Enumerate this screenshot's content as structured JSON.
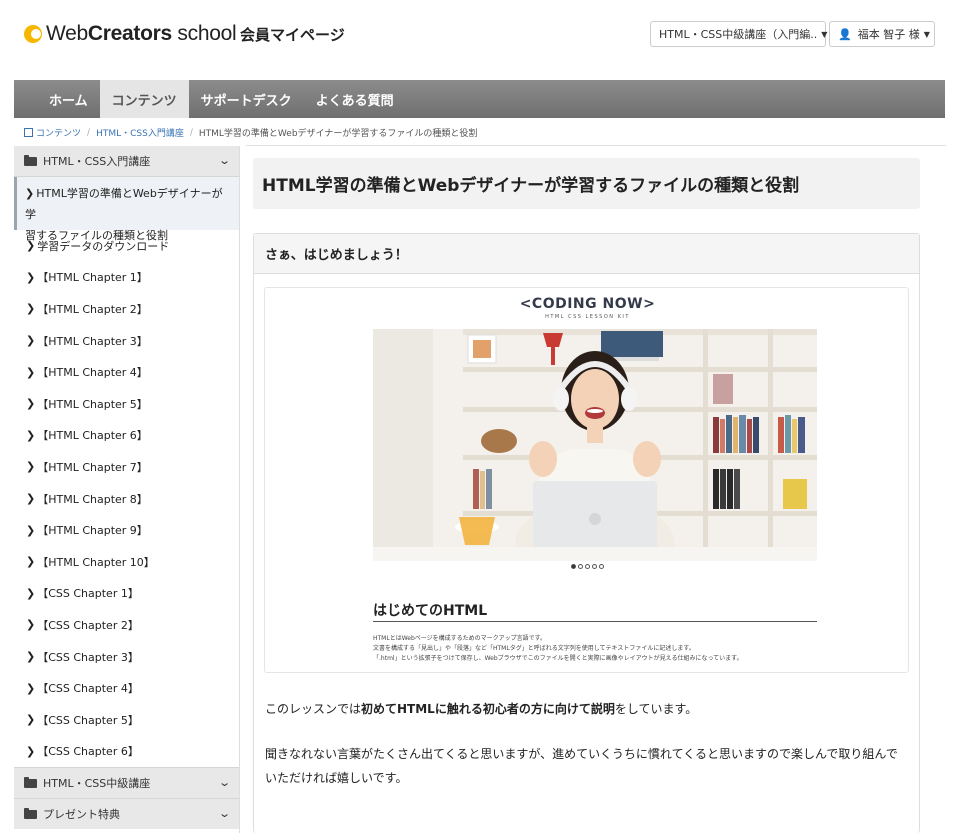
{
  "header": {
    "logo_web": "Web",
    "logo_creators": "Creators",
    "logo_school": "school",
    "mypage": "会員マイページ",
    "course_selector": "HTML・CSS中級講座（入門編..",
    "user": "福本 智子 様"
  },
  "nav": {
    "items": [
      {
        "label": "ホーム"
      },
      {
        "label": "コンテンツ",
        "active": true
      },
      {
        "label": "サポートデスク"
      },
      {
        "label": "よくある質問"
      }
    ]
  },
  "breadcrumb": {
    "items": [
      "コンテンツ",
      "HTML・CSS入門講座",
      "HTML学習の準備とWebデザイナーが学習するファイルの種類と役割"
    ]
  },
  "sidebar": {
    "section_title": "HTML・CSS入門講座",
    "current_line1": "HTML学習の準備とWebデザイナーが学",
    "current_line2": "習するファイルの種類と役割",
    "download": "学習データのダウンロード",
    "chapters": [
      "【HTML Chapter 1】",
      "【HTML Chapter 2】",
      "【HTML Chapter 3】",
      "【HTML Chapter 4】",
      "【HTML Chapter 5】",
      "【HTML Chapter 6】",
      "【HTML Chapter 7】",
      "【HTML Chapter 8】",
      "【HTML Chapter 9】",
      "【HTML Chapter 10】",
      "【CSS Chapter 1】",
      "【CSS Chapter 2】",
      "【CSS Chapter 3】",
      "【CSS Chapter 4】",
      "【CSS Chapter 5】",
      "【CSS Chapter 6】"
    ],
    "groups": [
      "HTML・CSS中級講座",
      "プレゼント特典"
    ]
  },
  "main": {
    "title": "HTML学習の準備とWebデザイナーが学習するファイルの種類と役割",
    "panel_heading": "さぁ、はじめましょう！",
    "slide": {
      "logo": "<CODING NOW>",
      "subtitle": "HTML CSS  LESSON KIT",
      "heading": "はじめてのHTML",
      "text1": "HTMLとはWebページを構成するためのマークアップ言語です。",
      "text2": "文書を構成する「見出し」や「段落」など「HTMLタグ」と呼ばれる文字列を使用してテキストファイルに記述します。",
      "text3": "「.html」という拡張子をつけて保存し、Webブラウザでこのファイルを開くと実際に画像やレイアウトが見える仕組みになっています。"
    },
    "para1_a": "このレッスンでは",
    "para1_b": "初めてHTMLに触れる初心者の方に向けて説明",
    "para1_c": "をしています。",
    "para2": "聞きなれない言葉がたくさん出てくると思いますが、進めていくうちに慣れてくると思いますので楽しんで取り組んでいただければ嬉しいです。"
  },
  "colors": {
    "nav_bg": "#7d7d7d",
    "logo_accent": "#f5b700",
    "link": "#3a73b5"
  }
}
